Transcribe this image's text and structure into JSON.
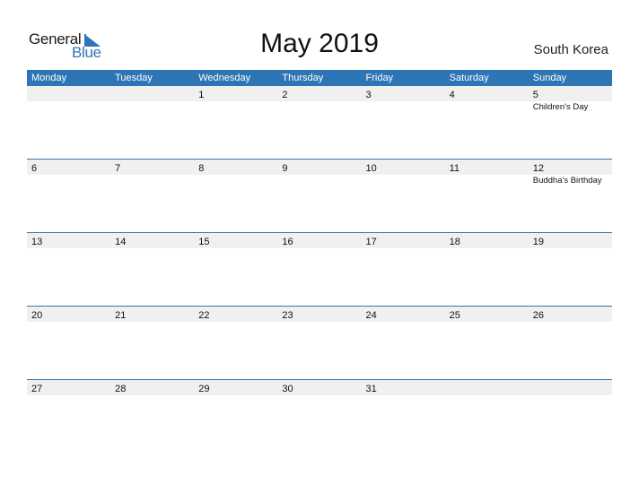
{
  "logo": {
    "text1": "General",
    "text2": "Blue"
  },
  "title": "May 2019",
  "country": "South Korea",
  "colors": {
    "accent": "#2e75b6",
    "band": "#f0f0f0"
  },
  "weekdays": [
    "Monday",
    "Tuesday",
    "Wednesday",
    "Thursday",
    "Friday",
    "Saturday",
    "Sunday"
  ],
  "weeks": [
    {
      "days": [
        "",
        "",
        "1",
        "2",
        "3",
        "4",
        "5"
      ],
      "holidays": [
        "",
        "",
        "",
        "",
        "",
        "",
        "Children's Day"
      ]
    },
    {
      "days": [
        "6",
        "7",
        "8",
        "9",
        "10",
        "11",
        "12"
      ],
      "holidays": [
        "",
        "",
        "",
        "",
        "",
        "",
        "Buddha's Birthday"
      ]
    },
    {
      "days": [
        "13",
        "14",
        "15",
        "16",
        "17",
        "18",
        "19"
      ],
      "holidays": [
        "",
        "",
        "",
        "",
        "",
        "",
        ""
      ]
    },
    {
      "days": [
        "20",
        "21",
        "22",
        "23",
        "24",
        "25",
        "26"
      ],
      "holidays": [
        "",
        "",
        "",
        "",
        "",
        "",
        ""
      ]
    },
    {
      "days": [
        "27",
        "28",
        "29",
        "30",
        "31",
        "",
        ""
      ],
      "holidays": [
        "",
        "",
        "",
        "",
        "",
        "",
        ""
      ]
    }
  ]
}
